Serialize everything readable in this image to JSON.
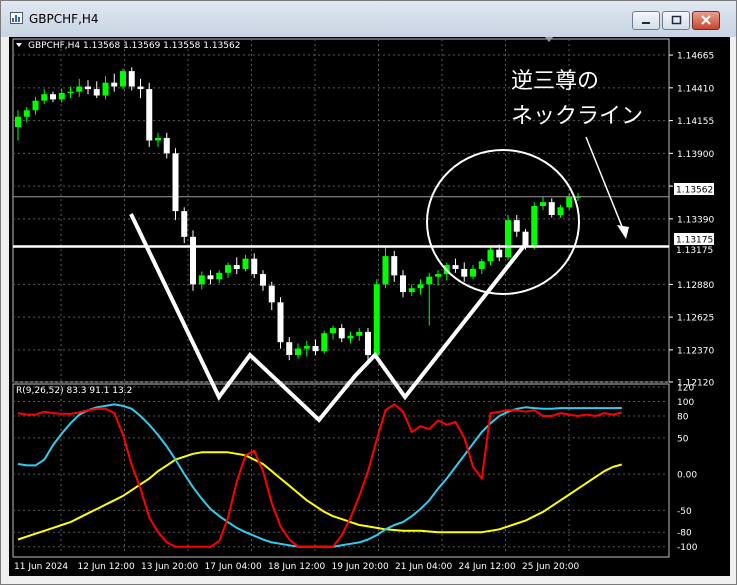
{
  "window": {
    "title": "GBPCHF,H4"
  },
  "colors": {
    "bull": "#00ff00",
    "bear": "#ffffff",
    "fast": "#ff0000",
    "signal": "#ffff00",
    "slow": "#33ccee",
    "grid": "#5a5a5a",
    "axis_text": "#ffffff",
    "bg": "#000000"
  },
  "price_panel": {
    "header": "GBPCHF,H4  1.13568 1.13569 1.13558 1.13562",
    "current_price": "1.13562",
    "current_value": 1.13562,
    "neckline_label": "1.13175",
    "neckline_value": 1.13175,
    "extra_label": "1.13175",
    "y_ticks": [
      "1.14665",
      "1.14410",
      "1.14155",
      "1.13900",
      "1.13645",
      "1.13390",
      "1.12880",
      "1.12625",
      "1.12370",
      "1.12120"
    ],
    "annotation_line1": "逆三尊の",
    "annotation_line2": "ネックライン"
  },
  "indicator_panel": {
    "header": "R(9,26,52) 83.3 91.1 13.2",
    "y_ticks": [
      "120",
      "100",
      "80",
      "50",
      "0.00",
      "-50",
      "-80",
      "-100"
    ]
  },
  "x_axis": {
    "labels": [
      "11 Jun 2024",
      "12 Jun 12:00",
      "13 Jun 20:00",
      "17 Jun 04:00",
      "18 Jun 12:00",
      "19 Jun 20:00",
      "21 Jun 04:00",
      "24 Jun 12:00",
      "25 Jun 20:00"
    ]
  },
  "chart_data": {
    "type": "candlestick",
    "symbol": "GBPCHF",
    "timeframe": "H4",
    "price_range": [
      1.1212,
      1.1479
    ],
    "candles": [
      {
        "o": 1.14105,
        "h": 1.14235,
        "l": 1.14,
        "c": 1.14185
      },
      {
        "o": 1.14185,
        "h": 1.1426,
        "l": 1.1414,
        "c": 1.14235
      },
      {
        "o": 1.14235,
        "h": 1.1434,
        "l": 1.142,
        "c": 1.1431
      },
      {
        "o": 1.1431,
        "h": 1.144,
        "l": 1.14285,
        "c": 1.1436
      },
      {
        "o": 1.1436,
        "h": 1.1438,
        "l": 1.143,
        "c": 1.1432
      },
      {
        "o": 1.1432,
        "h": 1.14405,
        "l": 1.14295,
        "c": 1.1437
      },
      {
        "o": 1.1437,
        "h": 1.1442,
        "l": 1.1433,
        "c": 1.1438
      },
      {
        "o": 1.1438,
        "h": 1.1448,
        "l": 1.1434,
        "c": 1.1442
      },
      {
        "o": 1.1442,
        "h": 1.1447,
        "l": 1.1436,
        "c": 1.144
      },
      {
        "o": 1.144,
        "h": 1.1446,
        "l": 1.1433,
        "c": 1.1435
      },
      {
        "o": 1.1435,
        "h": 1.145,
        "l": 1.1432,
        "c": 1.1445
      },
      {
        "o": 1.1445,
        "h": 1.1452,
        "l": 1.1438,
        "c": 1.1442
      },
      {
        "o": 1.1442,
        "h": 1.1456,
        "l": 1.144,
        "c": 1.1454
      },
      {
        "o": 1.1454,
        "h": 1.1457,
        "l": 1.1439,
        "c": 1.1442
      },
      {
        "o": 1.1442,
        "h": 1.1448,
        "l": 1.1433,
        "c": 1.144
      },
      {
        "o": 1.144,
        "h": 1.1445,
        "l": 1.1395,
        "c": 1.14
      },
      {
        "o": 1.14,
        "h": 1.1406,
        "l": 1.1395,
        "c": 1.1402
      },
      {
        "o": 1.1402,
        "h": 1.1406,
        "l": 1.1386,
        "c": 1.139
      },
      {
        "o": 1.139,
        "h": 1.1394,
        "l": 1.1338,
        "c": 1.1345
      },
      {
        "o": 1.1345,
        "h": 1.1348,
        "l": 1.132,
        "c": 1.1325
      },
      {
        "o": 1.1325,
        "h": 1.133,
        "l": 1.1283,
        "c": 1.1288
      },
      {
        "o": 1.1288,
        "h": 1.1298,
        "l": 1.1284,
        "c": 1.1295
      },
      {
        "o": 1.1295,
        "h": 1.1299,
        "l": 1.1288,
        "c": 1.1292
      },
      {
        "o": 1.1292,
        "h": 1.1299,
        "l": 1.1289,
        "c": 1.1297
      },
      {
        "o": 1.1297,
        "h": 1.1305,
        "l": 1.1293,
        "c": 1.1303
      },
      {
        "o": 1.1303,
        "h": 1.1309,
        "l": 1.1296,
        "c": 1.13
      },
      {
        "o": 1.13,
        "h": 1.1311,
        "l": 1.1298,
        "c": 1.1308
      },
      {
        "o": 1.1308,
        "h": 1.1312,
        "l": 1.1293,
        "c": 1.1296
      },
      {
        "o": 1.1296,
        "h": 1.1299,
        "l": 1.1283,
        "c": 1.1287
      },
      {
        "o": 1.1287,
        "h": 1.129,
        "l": 1.1268,
        "c": 1.1274
      },
      {
        "o": 1.1274,
        "h": 1.1278,
        "l": 1.1238,
        "c": 1.1243
      },
      {
        "o": 1.1243,
        "h": 1.1247,
        "l": 1.1229,
        "c": 1.1233
      },
      {
        "o": 1.1233,
        "h": 1.1242,
        "l": 1.123,
        "c": 1.1238
      },
      {
        "o": 1.1238,
        "h": 1.1244,
        "l": 1.1232,
        "c": 1.124
      },
      {
        "o": 1.124,
        "h": 1.1245,
        "l": 1.1233,
        "c": 1.1236
      },
      {
        "o": 1.1236,
        "h": 1.1252,
        "l": 1.1234,
        "c": 1.125
      },
      {
        "o": 1.125,
        "h": 1.1256,
        "l": 1.1245,
        "c": 1.1254
      },
      {
        "o": 1.1254,
        "h": 1.1257,
        "l": 1.1243,
        "c": 1.1246
      },
      {
        "o": 1.1246,
        "h": 1.1251,
        "l": 1.1242,
        "c": 1.1248
      },
      {
        "o": 1.1248,
        "h": 1.1254,
        "l": 1.1244,
        "c": 1.1251
      },
      {
        "o": 1.1251,
        "h": 1.1254,
        "l": 1.1228,
        "c": 1.1233
      },
      {
        "o": 1.1233,
        "h": 1.1292,
        "l": 1.123,
        "c": 1.1288
      },
      {
        "o": 1.1288,
        "h": 1.1318,
        "l": 1.1285,
        "c": 1.131
      },
      {
        "o": 1.131,
        "h": 1.1314,
        "l": 1.129,
        "c": 1.1295
      },
      {
        "o": 1.1295,
        "h": 1.1299,
        "l": 1.1278,
        "c": 1.1282
      },
      {
        "o": 1.1282,
        "h": 1.1288,
        "l": 1.1279,
        "c": 1.1285
      },
      {
        "o": 1.1285,
        "h": 1.1292,
        "l": 1.128,
        "c": 1.1288
      },
      {
        "o": 1.1288,
        "h": 1.1297,
        "l": 1.1256,
        "c": 1.1294
      },
      {
        "o": 1.1294,
        "h": 1.1299,
        "l": 1.1287,
        "c": 1.1296
      },
      {
        "o": 1.1296,
        "h": 1.1305,
        "l": 1.1291,
        "c": 1.1303
      },
      {
        "o": 1.1303,
        "h": 1.1308,
        "l": 1.1297,
        "c": 1.13
      },
      {
        "o": 1.13,
        "h": 1.1305,
        "l": 1.129,
        "c": 1.1294
      },
      {
        "o": 1.1294,
        "h": 1.1303,
        "l": 1.1292,
        "c": 1.13
      },
      {
        "o": 1.13,
        "h": 1.1308,
        "l": 1.1296,
        "c": 1.1306
      },
      {
        "o": 1.1306,
        "h": 1.1318,
        "l": 1.1303,
        "c": 1.1315
      },
      {
        "o": 1.1315,
        "h": 1.1319,
        "l": 1.1306,
        "c": 1.1309
      },
      {
        "o": 1.1309,
        "h": 1.1342,
        "l": 1.1307,
        "c": 1.1338
      },
      {
        "o": 1.1338,
        "h": 1.1342,
        "l": 1.1325,
        "c": 1.1329
      },
      {
        "o": 1.1329,
        "h": 1.1331,
        "l": 1.1315,
        "c": 1.1318
      },
      {
        "o": 1.1318,
        "h": 1.1352,
        "l": 1.1315,
        "c": 1.1349
      },
      {
        "o": 1.1349,
        "h": 1.1356,
        "l": 1.1346,
        "c": 1.1352
      },
      {
        "o": 1.1352,
        "h": 1.1355,
        "l": 1.134,
        "c": 1.1342
      },
      {
        "o": 1.1342,
        "h": 1.135,
        "l": 1.134,
        "c": 1.1348
      },
      {
        "o": 1.1348,
        "h": 1.1359,
        "l": 1.1346,
        "c": 1.1356
      },
      {
        "o": 1.1356,
        "h": 1.1359,
        "l": 1.1353,
        "c": 1.13562
      }
    ],
    "oscillator": {
      "fast": [
        84,
        82,
        82,
        86,
        84,
        83,
        83,
        85,
        88,
        90,
        90,
        84,
        54,
        12,
        -20,
        -60,
        -80,
        -94,
        -100,
        -100,
        -100,
        -100,
        -100,
        -92,
        -60,
        -10,
        26,
        32,
        4,
        -40,
        -72,
        -90,
        -100,
        -100,
        -100,
        -100,
        -100,
        -84,
        -60,
        -30,
        4,
        48,
        88,
        96,
        86,
        58,
        66,
        62,
        74,
        68,
        72,
        50,
        10,
        -6,
        84,
        86,
        88,
        88,
        86,
        88,
        80,
        80,
        84,
        82,
        80,
        82,
        80,
        84,
        82,
        85
      ],
      "signal": [
        -90,
        -86,
        -82,
        -78,
        -74,
        -70,
        -66,
        -60,
        -54,
        -48,
        -42,
        -36,
        -30,
        -22,
        -14,
        -6,
        4,
        12,
        20,
        24,
        28,
        30,
        30,
        30,
        30,
        28,
        26,
        20,
        14,
        4,
        -6,
        -16,
        -26,
        -36,
        -44,
        -52,
        -58,
        -62,
        -66,
        -70,
        -72,
        -74,
        -76,
        -77,
        -78,
        -78,
        -78,
        -79,
        -80,
        -80,
        -80,
        -80,
        -80,
        -80,
        -78,
        -76,
        -72,
        -68,
        -64,
        -58,
        -52,
        -44,
        -36,
        -28,
        -20,
        -12,
        -4,
        4,
        10,
        13.2
      ],
      "slow": [
        14,
        12,
        12,
        20,
        40,
        56,
        70,
        82,
        88,
        92,
        94,
        96,
        94,
        90,
        80,
        68,
        54,
        38,
        20,
        0,
        -18,
        -34,
        -48,
        -58,
        -66,
        -74,
        -80,
        -85,
        -90,
        -94,
        -96,
        -98,
        -100,
        -100,
        -100,
        -100,
        -100,
        -98,
        -96,
        -94,
        -90,
        -84,
        -76,
        -70,
        -66,
        -58,
        -48,
        -36,
        -20,
        -6,
        10,
        26,
        42,
        58,
        70,
        80,
        86,
        90,
        92,
        91,
        90,
        90,
        91,
        91,
        91,
        91,
        91,
        91,
        91,
        91.1
      ],
      "range": [
        -110,
        120
      ]
    }
  }
}
